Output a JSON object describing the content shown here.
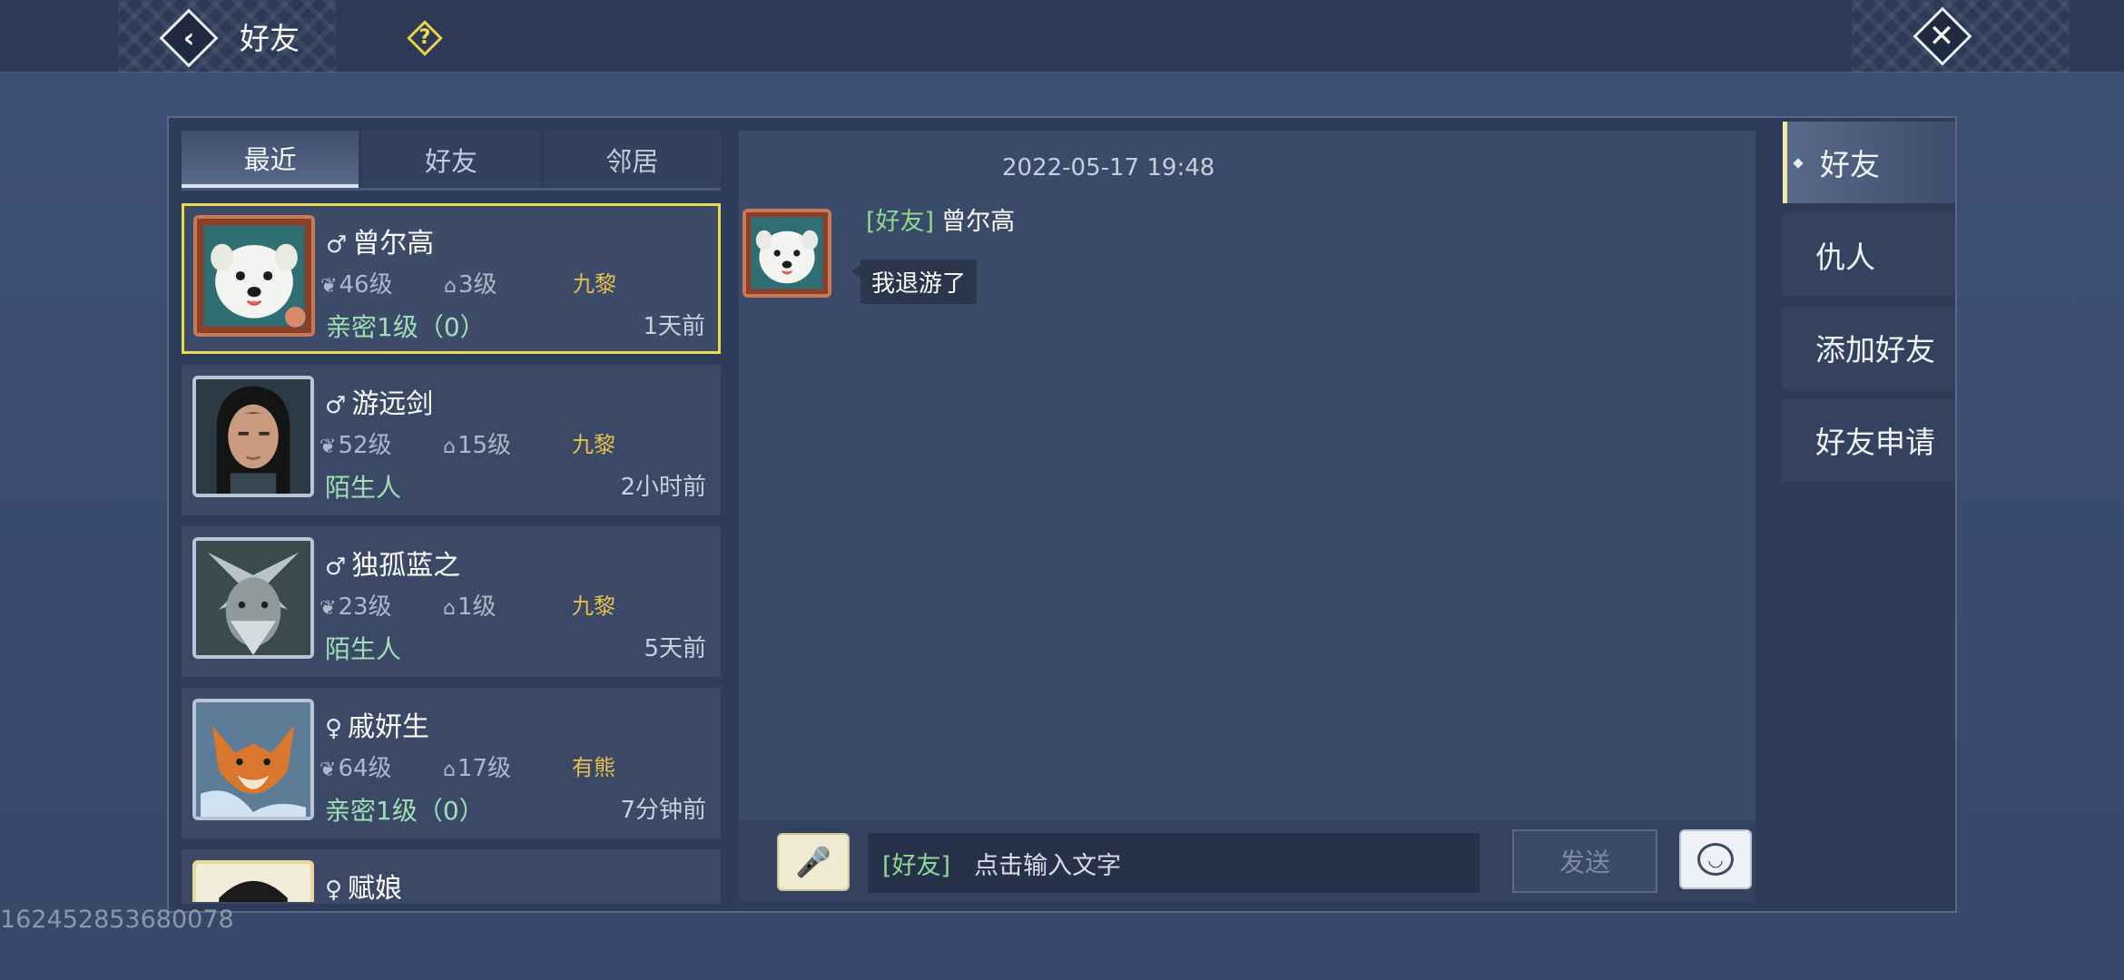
{
  "header": {
    "title": "好友",
    "back_icon": "‹",
    "help_icon": "?",
    "close_icon": "✕"
  },
  "tabs": [
    {
      "label": "最近",
      "active": true
    },
    {
      "label": "好友",
      "active": false
    },
    {
      "label": "邻居",
      "active": false
    }
  ],
  "friends": [
    {
      "gender": "♂",
      "name": "曾尔高",
      "level": "46级",
      "home_level": "3级",
      "server": "九黎",
      "relation": "亲密1级（0）",
      "time": "1天前",
      "avatar": "white-dog",
      "selected": true
    },
    {
      "gender": "♂",
      "name": "游远剑",
      "level": "52级",
      "home_level": "15级",
      "server": "九黎",
      "relation": "陌生人",
      "time": "2小时前",
      "avatar": "male-portrait",
      "selected": false
    },
    {
      "gender": "♂",
      "name": "独孤蓝之",
      "level": "23级",
      "home_level": "1级",
      "server": "九黎",
      "relation": "陌生人",
      "time": "5天前",
      "avatar": "silver-beast",
      "selected": false
    },
    {
      "gender": "♀",
      "name": "戚妍生",
      "level": "64级",
      "home_level": "17级",
      "server": "有熊",
      "relation": "亲密1级（0）",
      "time": "7分钟前",
      "avatar": "orange-fox",
      "selected": false
    },
    {
      "gender": "♀",
      "name": "赋娘",
      "level": "",
      "home_level": "",
      "server": "",
      "relation": "",
      "time": "",
      "avatar": "female-portrait",
      "selected": false
    }
  ],
  "chat": {
    "timestamp": "2022-05-17  19:48",
    "message": {
      "tag": "[好友]",
      "sender": "曾尔高",
      "text": "我退游了"
    },
    "input_tag": "[好友]",
    "input_placeholder": "点击输入文字",
    "send_label": "发送"
  },
  "side_menu": [
    {
      "label": "好友",
      "active": true
    },
    {
      "label": "仇人",
      "active": false
    },
    {
      "label": "添加好友",
      "active": false
    },
    {
      "label": "好友申请",
      "active": false
    }
  ],
  "watermark": "162452853680078"
}
